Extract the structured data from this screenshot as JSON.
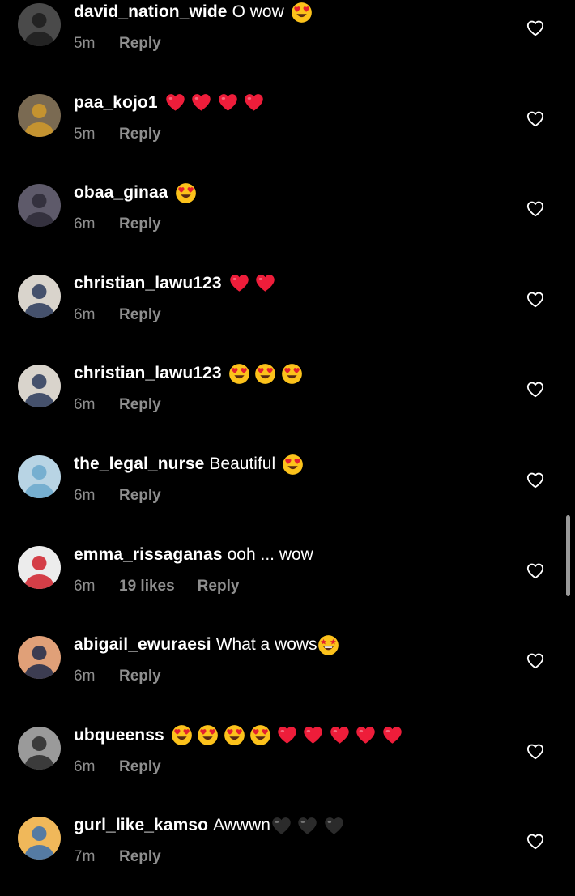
{
  "colors": {
    "background": "#000000",
    "text": "#ffffff",
    "secondary_text": "#8e8e8e",
    "red_heart": "#ee1d3a",
    "black_heart": "#2b2b2b",
    "emoji_face": "#fcc21b"
  },
  "comments": [
    {
      "username": "david_nation_wide",
      "text": "O wow",
      "emojis": [
        "heart-eyes-emoji"
      ],
      "time": "5m",
      "likes": "",
      "reply": "Reply",
      "avatar": {
        "bg": "#4a4a4a",
        "fg": "#1c1c1c"
      }
    },
    {
      "username": "paa_kojo1",
      "text": "",
      "emojis": [
        "red-heart-emoji",
        "red-heart-emoji",
        "red-heart-emoji",
        "red-heart-emoji"
      ],
      "time": "5m",
      "likes": "",
      "reply": "Reply",
      "avatar": {
        "bg": "#7a6a52",
        "fg": "#d19a2a"
      }
    },
    {
      "username": "obaa_ginaa",
      "text": "",
      "emojis": [
        "heart-eyes-emoji"
      ],
      "time": "6m",
      "likes": "",
      "reply": "Reply",
      "avatar": {
        "bg": "#5e5a6a",
        "fg": "#2d2a36"
      }
    },
    {
      "username": "christian_lawu123",
      "text": "",
      "emojis": [
        "red-heart-emoji",
        "red-heart-emoji"
      ],
      "time": "6m",
      "likes": "",
      "reply": "Reply",
      "avatar": {
        "bg": "#d9d4cc",
        "fg": "#2a3a5a"
      }
    },
    {
      "username": "christian_lawu123",
      "text": "",
      "emojis": [
        "heart-eyes-emoji",
        "heart-eyes-emoji",
        "heart-eyes-emoji"
      ],
      "time": "6m",
      "likes": "",
      "reply": "Reply",
      "avatar": {
        "bg": "#d9d4cc",
        "fg": "#2a3a5a"
      }
    },
    {
      "username": "the_legal_nurse",
      "text": "Beautiful",
      "emojis": [
        "heart-eyes-emoji"
      ],
      "time": "6m",
      "likes": "",
      "reply": "Reply",
      "avatar": {
        "bg": "#b8d4e4",
        "fg": "#6aa8cc"
      }
    },
    {
      "username": "emma_rissaganas",
      "text": "ooh ... wow",
      "emojis": [],
      "time": "6m",
      "likes": "19 likes",
      "reply": "Reply",
      "avatar": {
        "bg": "#ececec",
        "fg": "#d0202a"
      }
    },
    {
      "username": "abigail_ewuraesi",
      "text": "What a wows",
      "emojis": [
        "star-struck-emoji"
      ],
      "time": "6m",
      "likes": "",
      "reply": "Reply",
      "avatar": {
        "bg": "#e0a078",
        "fg": "#1e2a4a"
      }
    },
    {
      "username": "ubqueenss",
      "text": "",
      "emojis": [
        "heart-eyes-emoji",
        "heart-eyes-emoji",
        "heart-eyes-emoji",
        "heart-eyes-emoji",
        "red-heart-emoji",
        "red-heart-emoji",
        "red-heart-emoji",
        "red-heart-emoji",
        "red-heart-emoji"
      ],
      "time": "6m",
      "likes": "",
      "reply": "Reply",
      "avatar": {
        "bg": "#9a9a9a",
        "fg": "#2a2a2a"
      }
    },
    {
      "username": "gurl_like_kamso",
      "text": "Awwwn",
      "emojis": [
        "black-heart-emoji",
        "black-heart-emoji",
        "black-heart-emoji"
      ],
      "time": "7m",
      "likes": "",
      "reply": "Reply",
      "avatar": {
        "bg": "#f0b85a",
        "fg": "#3a70b0"
      }
    }
  ]
}
